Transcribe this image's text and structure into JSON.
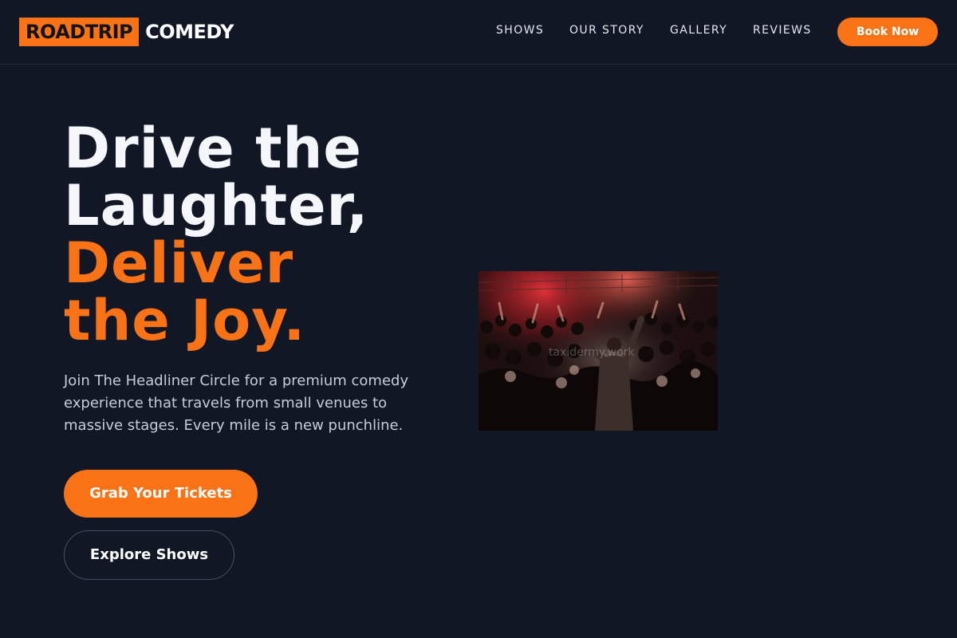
{
  "brand": {
    "logo_box": "ROADTRIP",
    "logo_rest": "COMEDY",
    "accent_color": "#f97316",
    "background_color": "#121726"
  },
  "nav": {
    "items": [
      {
        "label": "SHOWS"
      },
      {
        "label": "OUR STORY"
      },
      {
        "label": "GALLERY"
      },
      {
        "label": "REVIEWS"
      }
    ],
    "cta_label": "Book Now"
  },
  "hero": {
    "title_lines": [
      {
        "text": "Drive the",
        "tone": "white"
      },
      {
        "text": "Laughter,",
        "tone": "white"
      },
      {
        "text": "Deliver",
        "tone": "orange"
      },
      {
        "text": "the Joy.",
        "tone": "orange"
      }
    ],
    "description": "Join The Headliner Circle for a premium comedy experience that travels from small venues to massive stages. Every mile is a new punchline.",
    "primary_button": "Grab Your Tickets",
    "secondary_button": "Explore Shows"
  },
  "image": {
    "subject": "crowd-at-comedy-show-photo",
    "watermark": "taxidermy.work"
  }
}
